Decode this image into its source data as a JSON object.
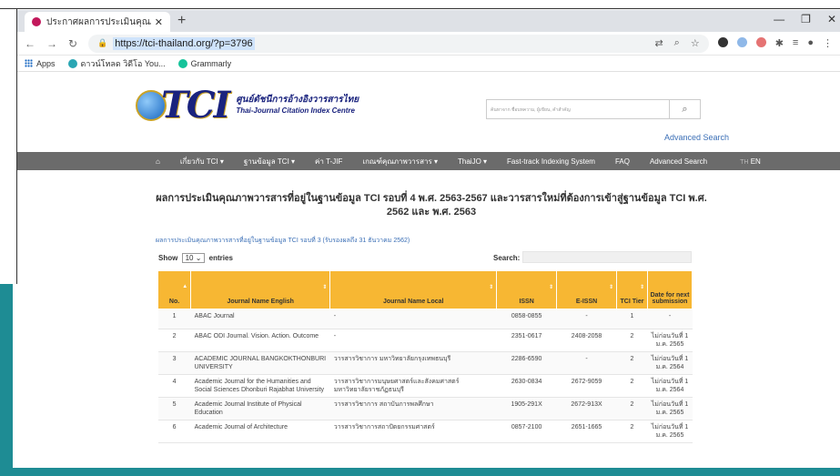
{
  "browser": {
    "tab_title": "ประกาศผลการประเมินคุณภาพวารสาร",
    "url": "https://tci-thailand.org/?p=3796",
    "bookmarks": [
      "Apps",
      "ดาวน์โหลด วิดีโอ You...",
      "Grammarly"
    ]
  },
  "site": {
    "logo_text": "TCI",
    "name_th": "ศูนย์ดัชนีการอ้างอิงวารสารไทย",
    "name_en": "Thai-Journal Citation Index Centre",
    "search_placeholder": "ค้นหาจาก ชื่อบทความ, ผู้เขียน, คำสำคัญ",
    "advanced_search": "Advanced Search"
  },
  "menu": {
    "items": [
      "เกี่ยวกับ TCI ▾",
      "ฐานข้อมูล TCI ▾",
      "ค่า T-JIF",
      "เกณฑ์คุณภาพวารสาร ▾",
      "ThaiJO ▾",
      "Fast-track Indexing System",
      "FAQ",
      "Advanced Search"
    ],
    "lang_th": "TH",
    "lang_en": "EN"
  },
  "content": {
    "title": "ผลการประเมินคุณภาพวารสารที่อยู่ในฐานข้อมูล TCI รอบที่ 4 พ.ศ. 2563-2567 และวารสารใหม่ที่ต้องการเข้าสู่ฐานข้อมูล TCI พ.ศ. 2562 และ พ.ศ. 2563",
    "sublink": "ผลการประเมินคุณภาพวารสารที่อยู่ในฐานข้อมูล TCI รอบที่ 3 (รับรองผลถึง 31 ธันวาคม 2562)",
    "show_label": "Show",
    "show_value": "10",
    "entries_label": "entries",
    "search_label": "Search:"
  },
  "table": {
    "headers": [
      "No.",
      "Journal Name English",
      "Journal Name Local",
      "ISSN",
      "E-ISSN",
      "TCI Tier",
      "Date for next submission"
    ],
    "rows": [
      [
        "1",
        "ABAC Journal",
        "-",
        "0858-0855",
        "-",
        "1",
        "-"
      ],
      [
        "2",
        "ABAC ODI Journal. Vision. Action. Outcome",
        "-",
        "2351-0617",
        "2408-2058",
        "2",
        "ไม่ก่อนวันที่ 1 ม.ค. 2565"
      ],
      [
        "3",
        "ACADEMIC JOURNAL BANGKOKTHONBURI UNIVERSITY",
        "วารสารวิชาการ มหาวิทยาลัยกรุงเทพธนบุรี",
        "2286-6590",
        "-",
        "2",
        "ไม่ก่อนวันที่ 1 ม.ค. 2564"
      ],
      [
        "4",
        "Academic Journal for the Humanities and Social Sciences Dhonburi Rajabhat University",
        "วารสารวิชาการมนุษยศาสตร์และสังคมศาสตร์ มหาวิทยาลัยราชภัฏธนบุรี",
        "2630-0834",
        "2672-9059",
        "2",
        "ไม่ก่อนวันที่ 1 ม.ค. 2564"
      ],
      [
        "5",
        "Academic Journal Institute of Physical Education",
        "วารสารวิชาการ สถาบันการพลศึกษา",
        "1905-291X",
        "2672-913X",
        "2",
        "ไม่ก่อนวันที่ 1 ม.ค. 2565"
      ],
      [
        "6",
        "Academic Journal of Architecture",
        "วารสารวิชาการสถาปัตยกรรมศาสตร์",
        "0857-2100",
        "2651-1665",
        "2",
        "ไม่ก่อนวันที่ 1 ม.ค. 2565"
      ]
    ]
  },
  "colors": {
    "accent": "#1e8c94",
    "menu_bg": "#6b6b6b",
    "table_header": "#f7b733",
    "link": "#3b6fb6"
  }
}
